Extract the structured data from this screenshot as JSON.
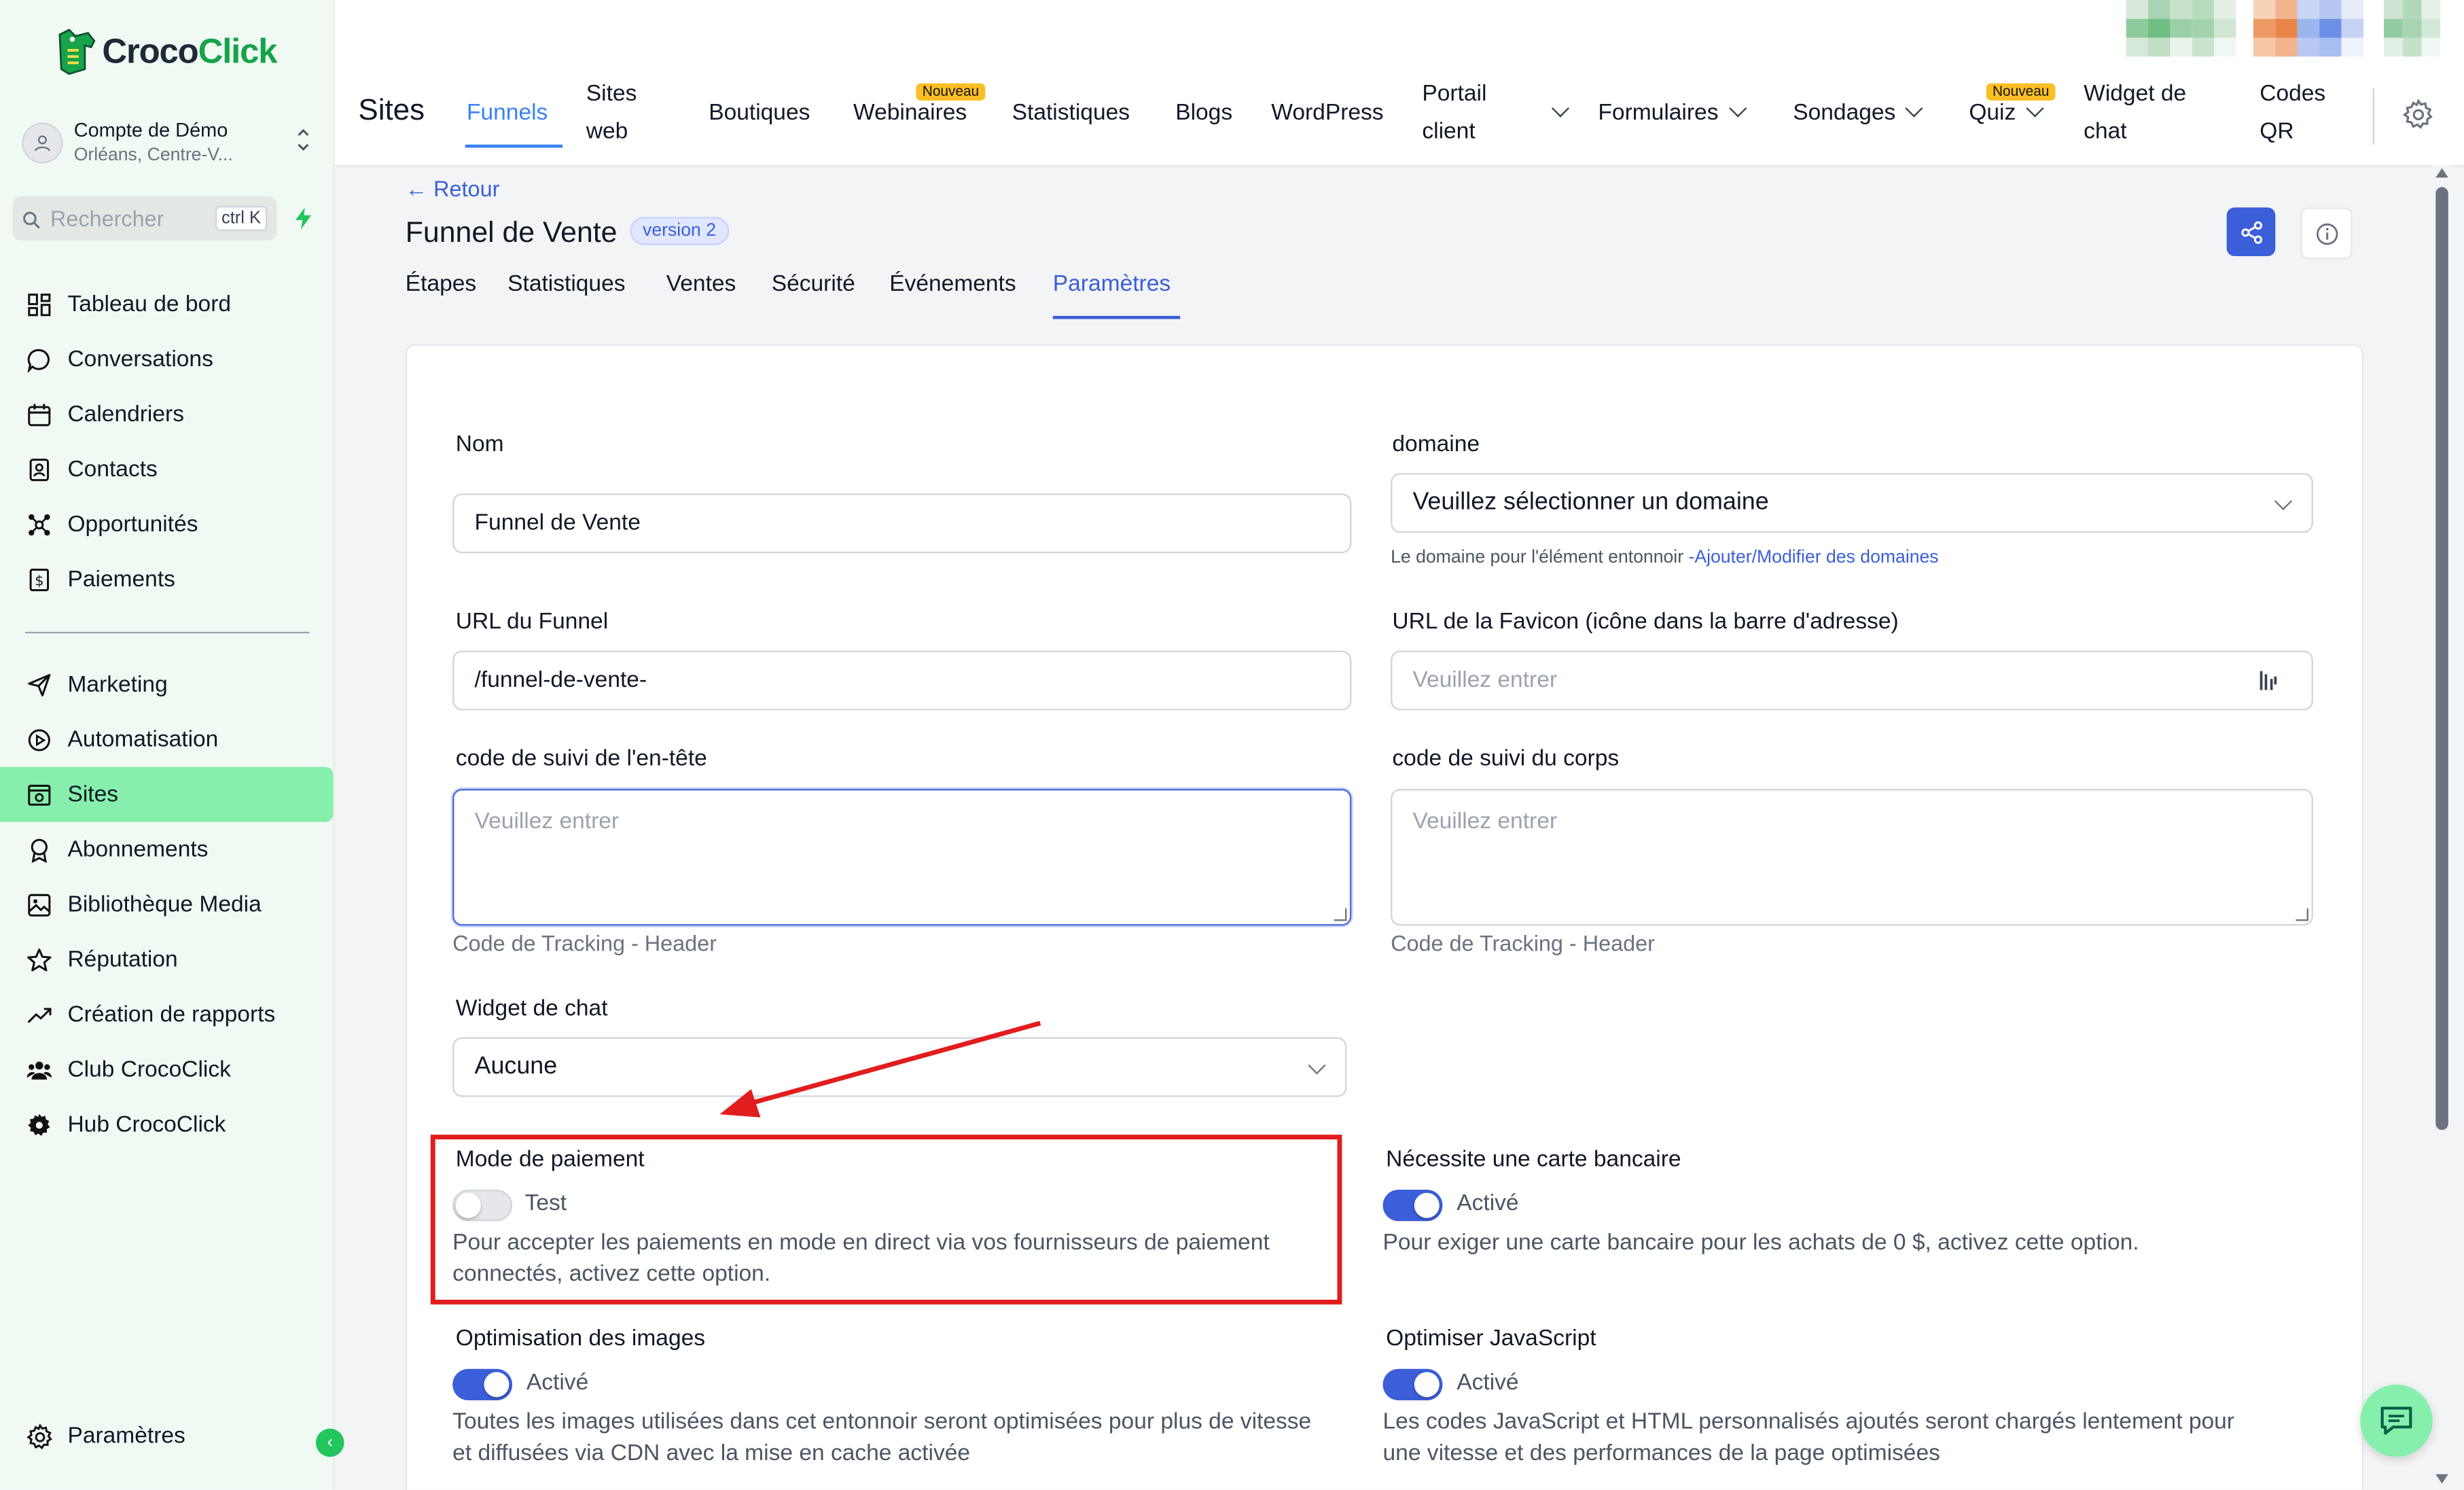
{
  "brand": {
    "name_part1": "Croco",
    "name_part2": "Click",
    "accent": "#16a34a"
  },
  "account": {
    "name": "Compte de Démo",
    "location": "Orléans, Centre-V..."
  },
  "search": {
    "placeholder": "Rechercher",
    "shortcut": "ctrl K"
  },
  "sidebar": {
    "items": [
      {
        "label": "Tableau de bord",
        "icon": "dashboard-icon"
      },
      {
        "label": "Conversations",
        "icon": "chat-bubble-icon"
      },
      {
        "label": "Calendriers",
        "icon": "calendar-icon"
      },
      {
        "label": "Contacts",
        "icon": "contacts-icon"
      },
      {
        "label": "Opportunités",
        "icon": "opportunities-icon"
      },
      {
        "label": "Paiements",
        "icon": "payments-icon"
      }
    ],
    "items2": [
      {
        "label": "Marketing",
        "icon": "send-icon"
      },
      {
        "label": "Automatisation",
        "icon": "automation-icon"
      },
      {
        "label": "Sites",
        "icon": "sites-icon",
        "active": true
      },
      {
        "label": "Abonnements",
        "icon": "badge-icon"
      },
      {
        "label": "Bibliothèque Media",
        "icon": "image-icon"
      },
      {
        "label": "Réputation",
        "icon": "star-icon"
      },
      {
        "label": "Création de rapports",
        "icon": "trend-icon"
      },
      {
        "label": "Club CrocoClick",
        "icon": "users-icon"
      },
      {
        "label": "Hub CrocoClick",
        "icon": "gear-icon"
      }
    ],
    "footer": "Paramètres",
    "active_color": "#86efac"
  },
  "topnav": {
    "title": "Sites",
    "tabs": {
      "funnels": "Funnels",
      "sites_web_1": "Sites",
      "sites_web_2": "web",
      "boutiques": "Boutiques",
      "webinaires": "Webinaires",
      "statistiques": "Statistiques",
      "blogs": "Blogs",
      "wordpress": "WordPress",
      "portail_1": "Portail",
      "portail_2": "client",
      "formulaires": "Formulaires",
      "sondages": "Sondages",
      "quiz": "Quiz",
      "widget_1": "Widget de",
      "widget_2": "chat",
      "codes_1": "Codes",
      "codes_2": "QR"
    },
    "new_badge": "Nouveau"
  },
  "page": {
    "back": "← Retour",
    "title": "Funnel de Vente",
    "version": "version 2",
    "subtabs": [
      "Étapes",
      "Statistiques",
      "Ventes",
      "Sécurité",
      "Événements",
      "Paramètres"
    ]
  },
  "form": {
    "nom_label": "Nom",
    "nom_value": "Funnel de Vente",
    "domaine_label": "domaine",
    "domaine_value": "Veuillez sélectionner un domaine",
    "domaine_help": "Le domaine pour l'élément entonnoir ",
    "domaine_link": "-Ajouter/Modifier des domaines",
    "url_label": "URL du Funnel",
    "url_value": "/funnel-de-vente-",
    "favicon_label": "URL de la Favicon (icône dans la barre d'adresse)",
    "favicon_placeholder": "Veuillez entrer",
    "head_label": "code de suivi de l'en-tête",
    "head_placeholder": "Veuillez entrer",
    "head_help": "Code de Tracking - Header",
    "body_label": "code de suivi du corps",
    "body_placeholder": "Veuillez entrer",
    "body_help": "Code de Tracking - Header",
    "widget_label": "Widget de chat",
    "widget_value": "Aucune",
    "payment_label": "Mode de paiement",
    "payment_state": "Test",
    "payment_desc_1": "Pour accepter les paiements en mode en direct via vos fournisseurs de paiement",
    "payment_desc_2": "connectés, activez cette option.",
    "payment_on": false,
    "card_label": "Nécessite une carte bancaire",
    "card_state": "Activé",
    "card_desc": "Pour exiger une carte bancaire pour les achats de 0 $, activez cette option.",
    "card_on": true,
    "images_label": "Optimisation des images",
    "images_state": "Activé",
    "images_desc_1": "Toutes les images utilisées dans cet entonnoir seront optimisées pour plus de vitesse",
    "images_desc_2": "et diffusées via CDN avec la mise en cache activée",
    "images_on": true,
    "js_label": "Optimiser JavaScript",
    "js_state": "Activé",
    "js_desc_1": "Les codes JavaScript et HTML personnalisés ajoutés seront chargés lentement pour",
    "js_desc_2": "une vitesse et des performances de la page optimisées",
    "js_on": true
  },
  "colors": {
    "primary": "#3b5fd9",
    "highlight": "#e11d1d"
  }
}
